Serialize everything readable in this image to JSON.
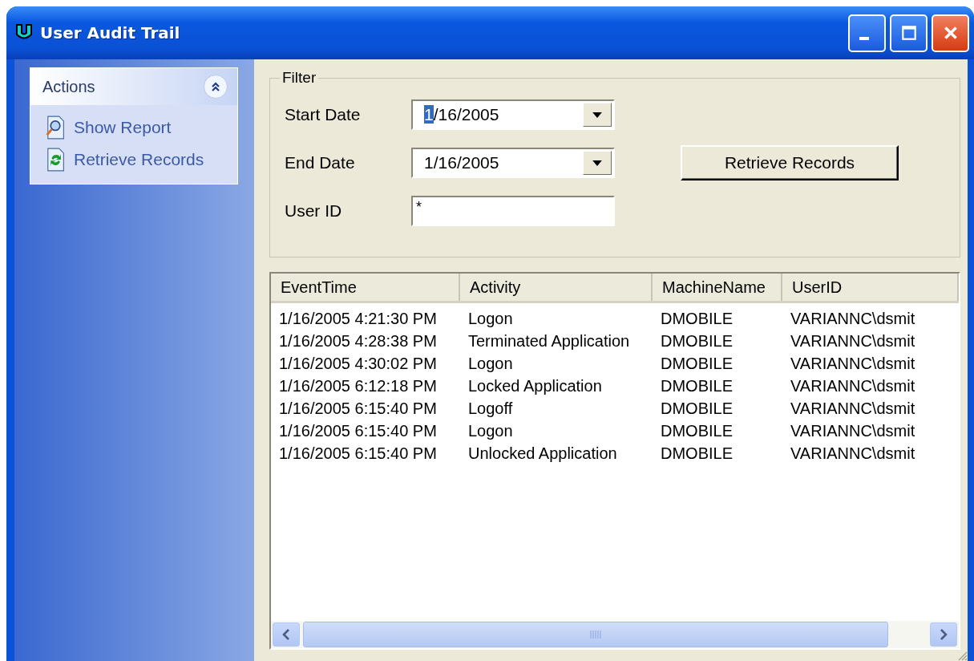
{
  "window": {
    "title": "User Audit Trail"
  },
  "actions": {
    "title": "Actions",
    "expanded": true,
    "items": [
      {
        "label": "Show Report",
        "kind": "report"
      },
      {
        "label": "Retrieve Records",
        "kind": "refresh"
      }
    ]
  },
  "filter": {
    "title": "Filter",
    "start_date": {
      "label": "Start Date",
      "value": "1/16/2005",
      "focused": true
    },
    "end_date": {
      "label": "End Date",
      "value": "1/16/2005",
      "focused": false
    },
    "user_id": {
      "label": "User ID",
      "value": "*"
    },
    "button": "Retrieve Records"
  },
  "table": {
    "columns": [
      "EventTime",
      "Activity",
      "MachineName",
      "UserID"
    ],
    "rows": [
      [
        "1/16/2005 4:21:30 PM",
        "Logon",
        "DMOBILE",
        "VARIANNC\\dsmit"
      ],
      [
        "1/16/2005 4:28:38 PM",
        "Terminated Application",
        "DMOBILE",
        "VARIANNC\\dsmit"
      ],
      [
        "1/16/2005 4:30:02 PM",
        "Logon",
        "DMOBILE",
        "VARIANNC\\dsmit"
      ],
      [
        "1/16/2005 6:12:18 PM",
        "Locked Application",
        "DMOBILE",
        "VARIANNC\\dsmit"
      ],
      [
        "1/16/2005 6:15:40 PM",
        "Logoff",
        "DMOBILE",
        "VARIANNC\\dsmit"
      ],
      [
        "1/16/2005 6:15:40 PM",
        "Logon",
        "DMOBILE",
        "VARIANNC\\dsmit"
      ],
      [
        "1/16/2005 6:15:40 PM",
        "Unlocked Application",
        "DMOBILE",
        "VARIANNC\\dsmit"
      ]
    ]
  }
}
